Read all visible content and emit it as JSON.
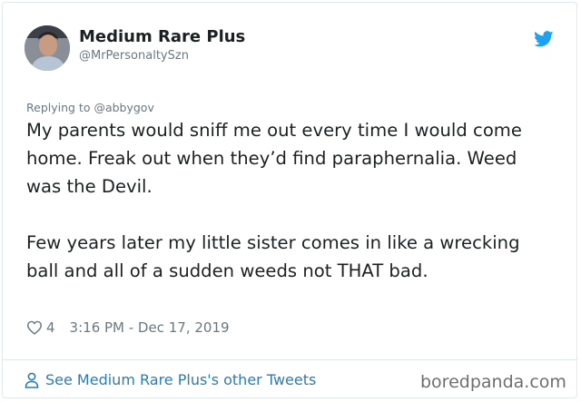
{
  "tweet": {
    "author_name": "Medium Rare Plus",
    "author_handle": "@MrPersonaltySzn",
    "replying_to": "Replying to @abbygov",
    "paragraphs": [
      "My parents would sniff me out every time I would come home. Freak out when they’d find paraphernalia. Weed was the Devil.",
      "Few years later my little sister comes in like a wrecking ball and all of a sudden weeds not THAT bad."
    ],
    "like_count": "4",
    "timestamp": "3:16 PM - Dec 17, 2019"
  },
  "footer": {
    "other_tweets_link": "See Medium Rare Plus's other Tweets"
  },
  "watermark": "boredpanda.com",
  "icons": {
    "brand": "twitter-bird-icon",
    "like": "heart-icon",
    "profile": "person-icon"
  },
  "colors": {
    "link": "#2b7bb9",
    "twitter_blue": "#1da1f2",
    "muted_text": "#697882"
  }
}
